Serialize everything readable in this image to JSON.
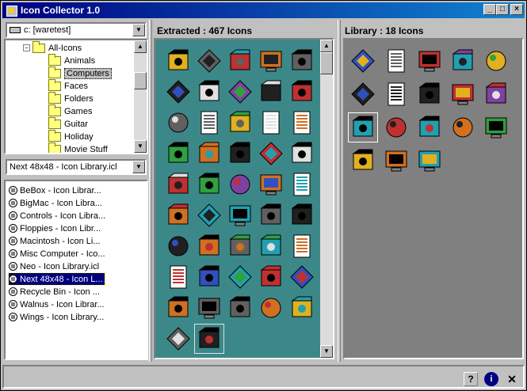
{
  "window": {
    "title": "Icon Collector 1.0",
    "buttons": [
      "_",
      "□",
      "×"
    ]
  },
  "left": {
    "drive": "c: [waretest]",
    "tree": {
      "parent": "All-Icons",
      "items": [
        "Animals",
        "Computers",
        "Faces",
        "Folders",
        "Games",
        "Guitar",
        "Holiday",
        "Movie Stuff"
      ],
      "selected": "Computers"
    },
    "library_select": "Next 48x48 - Icon Library.icl",
    "libraries": [
      "BeBox - Icon Librar...",
      "BigMac - Icon Libra...",
      "Controls - Icon Libra...",
      "Floppies - Icon Libr...",
      "Macintosh - Icon Li...",
      "Misc Computer - Ico...",
      "Neo - Icon Library.icl",
      "Next 48x48 - Icon L...",
      "Recycle Bin - Icon ...",
      "Walnus - Icon Librar...",
      "Wings - Icon Library..."
    ],
    "selected_library": "Next 48x48 - Icon L..."
  },
  "extracted": {
    "header": "Extracted : 467 Icons",
    "count": 467,
    "icons": [
      "windows-icon",
      "toolbox-icon",
      "lamp-icon",
      "painter-icon",
      "art-icon",
      "clr-icon",
      "books-icon",
      "monitor-icon",
      "document-icon",
      "phone-icon",
      "palette-icon",
      "cards-icon",
      "ps-document-icon",
      "compass-icon",
      "camera-icon",
      "scanner-icon",
      "keyboard-icon",
      "monitor-dark-icon",
      "help-screen-icon",
      "terminal-icon",
      "gears-icon",
      "puzzle-icon",
      "hands-icon",
      "sphere-icon",
      "window-text-icon",
      "sculpture-icon",
      "diamond-icon",
      "wand-icon",
      "handshake-icon",
      "sound-icon",
      "tools-icon",
      "tower-icon",
      "shape-icon",
      "tape-icon",
      "tar-box-icon",
      "text-window-icon",
      "text-page-icon",
      "display-icon",
      "tv-icon",
      "help-page-icon",
      "gauge-icon",
      "shield-icon",
      "pencil-box-icon",
      "plant-icon",
      "orb-icon",
      "disk-icon",
      "chip-window-icon"
    ],
    "selected": "chip-window-icon"
  },
  "library": {
    "header": "Library : 18 Icons",
    "count": 18,
    "icons": [
      "blue-cylinder-icon",
      "gear-ball-icon",
      "lightswitch-icon",
      "disk-drive-icon",
      "cd-icon",
      "gear-bolt-icon",
      "computer-icon",
      "tubes-icon",
      "lightning-icon",
      "fish-icon",
      "paint-jar-icon",
      "eraser-icon",
      "bug-icon",
      "recycle-bin-icon",
      "trash-icon",
      "jet-icon",
      "globe-icon",
      "clock-icon"
    ],
    "selected": "paint-jar-icon"
  },
  "status": {
    "help": "?",
    "info": "i",
    "close": "✕"
  },
  "colors": {
    "title_start": "#000080",
    "title_end": "#1084d0",
    "extracted_bg": "#3c8888",
    "library_bg": "#808080",
    "selection": "#000080"
  }
}
